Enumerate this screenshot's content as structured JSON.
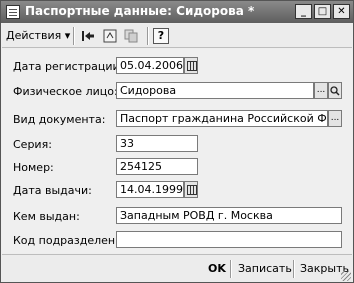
{
  "window": {
    "title": "Паспортные данные: Сидорова *",
    "minimize": "_",
    "maximize": "□",
    "close": "✕"
  },
  "toolbar": {
    "actions_label": "Действия",
    "actions_arrow": "▾",
    "icons": [
      "arrow-left-icon",
      "refresh-icon",
      "copy-icon",
      "help-icon"
    ],
    "help_glyph": "?"
  },
  "form": {
    "registration_date_label": "Дата регистрации:",
    "registration_date_value": "05.04.2006",
    "person_label": "Физическое лицо:",
    "person_value": "Сидорова",
    "doc_type_label": "Вид документа:",
    "doc_type_value": "Паспорт гражданина Российской Федер",
    "series_label": "Серия:",
    "series_value": "33",
    "number_label": "Номер:",
    "number_value": "254125",
    "issue_date_label": "Дата выдачи:",
    "issue_date_value": "14.04.1999",
    "issued_by_label": "Кем выдан:",
    "issued_by_value": "Западным РОВД г. Москва",
    "division_code_label": "Код подразделения:",
    "division_code_value": ""
  },
  "footer": {
    "ok_label": "OK",
    "save_label": "Записать",
    "close_label": "Закрыть"
  },
  "colors": {
    "titlebar": "#6f6f6f",
    "window_bg": "#eeeeee",
    "field_bg": "#ffffff"
  }
}
